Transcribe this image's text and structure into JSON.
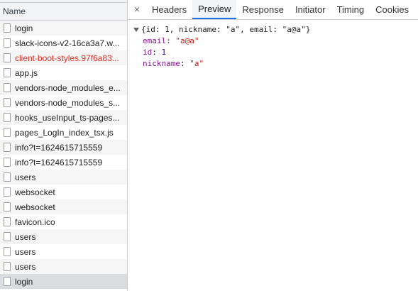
{
  "request_list": {
    "header": "Name",
    "items": [
      {
        "name": "login",
        "status": "normal"
      },
      {
        "name": "slack-icons-v2-16ca3a7.w...",
        "status": "normal"
      },
      {
        "name": "client-boot-styles.97f6a83...",
        "status": "error"
      },
      {
        "name": "app.js",
        "status": "normal"
      },
      {
        "name": "vendors-node_modules_e...",
        "status": "normal"
      },
      {
        "name": "vendors-node_modules_s...",
        "status": "normal"
      },
      {
        "name": "hooks_useInput_ts-pages...",
        "status": "normal"
      },
      {
        "name": "pages_LogIn_index_tsx.js",
        "status": "normal"
      },
      {
        "name": "info?t=1624615715559",
        "status": "normal"
      },
      {
        "name": "info?t=1624615715559",
        "status": "normal"
      },
      {
        "name": "users",
        "status": "normal"
      },
      {
        "name": "websocket",
        "status": "normal"
      },
      {
        "name": "websocket",
        "status": "normal"
      },
      {
        "name": "favicon.ico",
        "status": "normal"
      },
      {
        "name": "users",
        "status": "normal"
      },
      {
        "name": "users",
        "status": "normal"
      },
      {
        "name": "users",
        "status": "normal"
      },
      {
        "name": "login",
        "status": "selected"
      }
    ]
  },
  "details": {
    "close_glyph": "×",
    "tabs": [
      {
        "label": "Headers",
        "active": false
      },
      {
        "label": "Preview",
        "active": true
      },
      {
        "label": "Response",
        "active": false
      },
      {
        "label": "Initiator",
        "active": false
      },
      {
        "label": "Timing",
        "active": false
      },
      {
        "label": "Cookies",
        "active": false
      }
    ],
    "preview": {
      "summary": "{id: 1, nickname: \"a\", email: \"a@a\"}",
      "properties": [
        {
          "key": "email",
          "value": "\"a@a\"",
          "type": "string"
        },
        {
          "key": "id",
          "value": "1",
          "type": "number"
        },
        {
          "key": "nickname",
          "value": "\"a\"",
          "type": "string"
        }
      ]
    }
  },
  "colors": {
    "accent": "#1a73e8",
    "error_text": "#d93025",
    "json_key": "#881391",
    "json_string": "#c41a16",
    "json_number": "#1c00cf",
    "selected_row": "#dadce0"
  }
}
